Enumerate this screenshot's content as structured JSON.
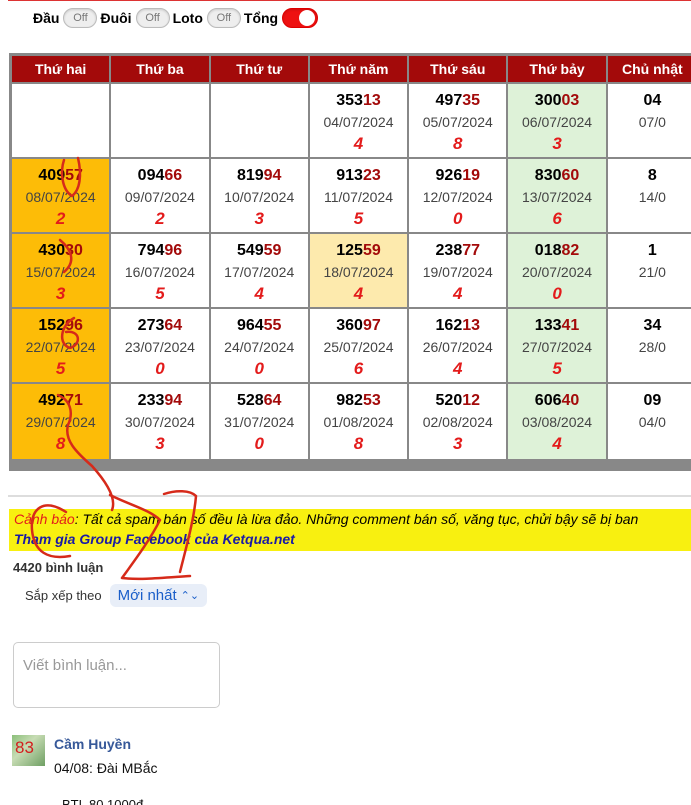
{
  "toggles": [
    {
      "label": "Đầu",
      "state": "Off"
    },
    {
      "label": "Đuôi",
      "state": "Off"
    },
    {
      "label": "Loto",
      "state": "Off"
    },
    {
      "label": "Tổng",
      "state": ""
    }
  ],
  "calendar": {
    "headers": [
      "Thứ hai",
      "Thứ ba",
      "Thứ tư",
      "Thứ năm",
      "Thứ sáu",
      "Thứ bảy",
      "Chủ nhật"
    ],
    "rows": [
      [
        {
          "lead": "",
          "tail": "",
          "date": "",
          "sum": ""
        },
        {
          "lead": "",
          "tail": "",
          "date": "",
          "sum": ""
        },
        {
          "lead": "",
          "tail": "",
          "date": "",
          "sum": ""
        },
        {
          "lead": "353",
          "tail": "13",
          "date": "04/07/2024",
          "sum": "4"
        },
        {
          "lead": "497",
          "tail": "35",
          "date": "05/07/2024",
          "sum": "8"
        },
        {
          "lead": "300",
          "tail": "03",
          "date": "06/07/2024",
          "sum": "3"
        },
        {
          "lead": "04",
          "tail": "",
          "date": "07/0",
          "sum": ""
        }
      ],
      [
        {
          "lead": "409",
          "tail": "57",
          "date": "08/07/2024",
          "sum": "2"
        },
        {
          "lead": "094",
          "tail": "66",
          "date": "09/07/2024",
          "sum": "2"
        },
        {
          "lead": "819",
          "tail": "94",
          "date": "10/07/2024",
          "sum": "3"
        },
        {
          "lead": "913",
          "tail": "23",
          "date": "11/07/2024",
          "sum": "5"
        },
        {
          "lead": "926",
          "tail": "19",
          "date": "12/07/2024",
          "sum": "0"
        },
        {
          "lead": "830",
          "tail": "60",
          "date": "13/07/2024",
          "sum": "6"
        },
        {
          "lead": "8",
          "tail": "",
          "date": "14/0",
          "sum": ""
        }
      ],
      [
        {
          "lead": "430",
          "tail": "30",
          "date": "15/07/2024",
          "sum": "3"
        },
        {
          "lead": "794",
          "tail": "96",
          "date": "16/07/2024",
          "sum": "5"
        },
        {
          "lead": "549",
          "tail": "59",
          "date": "17/07/2024",
          "sum": "4"
        },
        {
          "lead": "125",
          "tail": "59",
          "date": "18/07/2024",
          "sum": "4"
        },
        {
          "lead": "238",
          "tail": "77",
          "date": "19/07/2024",
          "sum": "4"
        },
        {
          "lead": "018",
          "tail": "82",
          "date": "20/07/2024",
          "sum": "0"
        },
        {
          "lead": "1",
          "tail": "",
          "date": "21/0",
          "sum": ""
        }
      ],
      [
        {
          "lead": "152",
          "tail": "96",
          "date": "22/07/2024",
          "sum": "5"
        },
        {
          "lead": "273",
          "tail": "64",
          "date": "23/07/2024",
          "sum": "0"
        },
        {
          "lead": "964",
          "tail": "55",
          "date": "24/07/2024",
          "sum": "0"
        },
        {
          "lead": "360",
          "tail": "97",
          "date": "25/07/2024",
          "sum": "6"
        },
        {
          "lead": "162",
          "tail": "13",
          "date": "26/07/2024",
          "sum": "4"
        },
        {
          "lead": "133",
          "tail": "41",
          "date": "27/07/2024",
          "sum": "5"
        },
        {
          "lead": "34",
          "tail": "",
          "date": "28/0",
          "sum": ""
        }
      ],
      [
        {
          "lead": "492",
          "tail": "71",
          "date": "29/07/2024",
          "sum": "8"
        },
        {
          "lead": "233",
          "tail": "94",
          "date": "30/07/2024",
          "sum": "3"
        },
        {
          "lead": "528",
          "tail": "64",
          "date": "31/07/2024",
          "sum": "0"
        },
        {
          "lead": "982",
          "tail": "53",
          "date": "01/08/2024",
          "sum": "8"
        },
        {
          "lead": "520",
          "tail": "12",
          "date": "02/08/2024",
          "sum": "3"
        },
        {
          "lead": "606",
          "tail": "40",
          "date": "03/08/2024",
          "sum": "4"
        },
        {
          "lead": "09",
          "tail": "",
          "date": "04/0",
          "sum": ""
        }
      ]
    ]
  },
  "warning": {
    "label": "Cảnh báo",
    "text": ": Tất cả spam bán số đều là lừa đảo. Những comment bán số, văng tục, chửi bậy sẽ bị ban",
    "group_link": "Tham gia Group Facebook của Ketqua.net"
  },
  "comments": {
    "count_label": "4420 bình luận",
    "sort_label": "Sắp xếp theo",
    "sort_value": "Mới nhất",
    "input_placeholder": "Viết bình luận...",
    "first": {
      "avatar_text": "83",
      "name": "Cầm Huyền",
      "text": "04/08: Đài MBắc",
      "text2": "BTL 80 1000đ"
    }
  },
  "colors": {
    "header_bg": "#a30a0a",
    "monday_bg": "#fdbc07",
    "saturday_bg": "#def2d8",
    "highlight_bg": "#fdeaad",
    "sum_color": "#e31b1b",
    "annotation_ink": "#d62a1a"
  }
}
